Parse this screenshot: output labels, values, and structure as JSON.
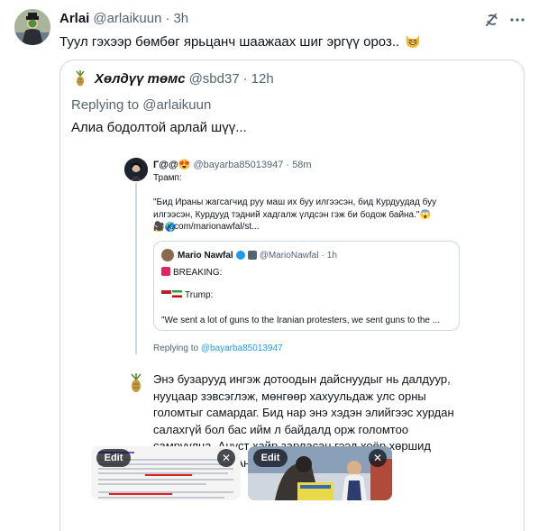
{
  "tweet": {
    "author_name": "Arlai",
    "author_handle": "@arlaikuun",
    "separator": "·",
    "time": "3h",
    "text": "Туул гэхээр бөмбөг ярьцанч шаажаах шиг эргүү ороз..",
    "text_emoji": "grinning-cat-emoji"
  },
  "header_icons": {
    "grok": "grok-icon",
    "more": "more-icon"
  },
  "quote": {
    "author_name": "Хөлдүү төмс",
    "author_handle": "@sbd37",
    "separator": "·",
    "time": "12h",
    "replying_prefix": "Replying to",
    "replying_handle": "@arlaikuun",
    "text": "Алиа бодолтой арлай шүү..."
  },
  "screenshot": {
    "name": "Г@@😍",
    "handle": "@bayarba85013947",
    "separator": "·",
    "time": "58m",
    "subtitle": "Трамп:",
    "body": "\"Бид Ираны жагсагчид руу маш их буу илгээсэн, бид Курдуудад буу илгээсэн, Курдууд тэдний хадгалж үлдсэн гэж би бодож байна.\"😱😱🌎",
    "link": "🎥 x.com/marionawfal/st...",
    "inner": {
      "name": "Mario Nawfal",
      "handle": "@MarioNawfal",
      "separator": "·",
      "time": "1h",
      "line1": "BREAKING:",
      "line2": "Trump:",
      "line3": "\"We sent a lot of guns to the Iranian protesters, we sent guns to the ..."
    },
    "replying_prefix": "Replying to",
    "replying_handle": "@bayarba85013947",
    "reply_body": "Энэ бузарууд ингэж дотоодын дайснуудыг нь далдуур, нууцаар зэвсэглэж, мөнгөөр хахуульдаж улс орны голомтыг самардаг. Бид нар энэ хэдэн элийгээс хурдан салахгүй бол бас ийм л байдалд орж голомтоо самруулна. Анyст хайр зарласан гээд хоёр хөршид бөмбөгдүүлнэ. Анус нь бас бөмбөгдөнө.",
    "edit_label": "Edit",
    "close_symbol": "✕"
  }
}
